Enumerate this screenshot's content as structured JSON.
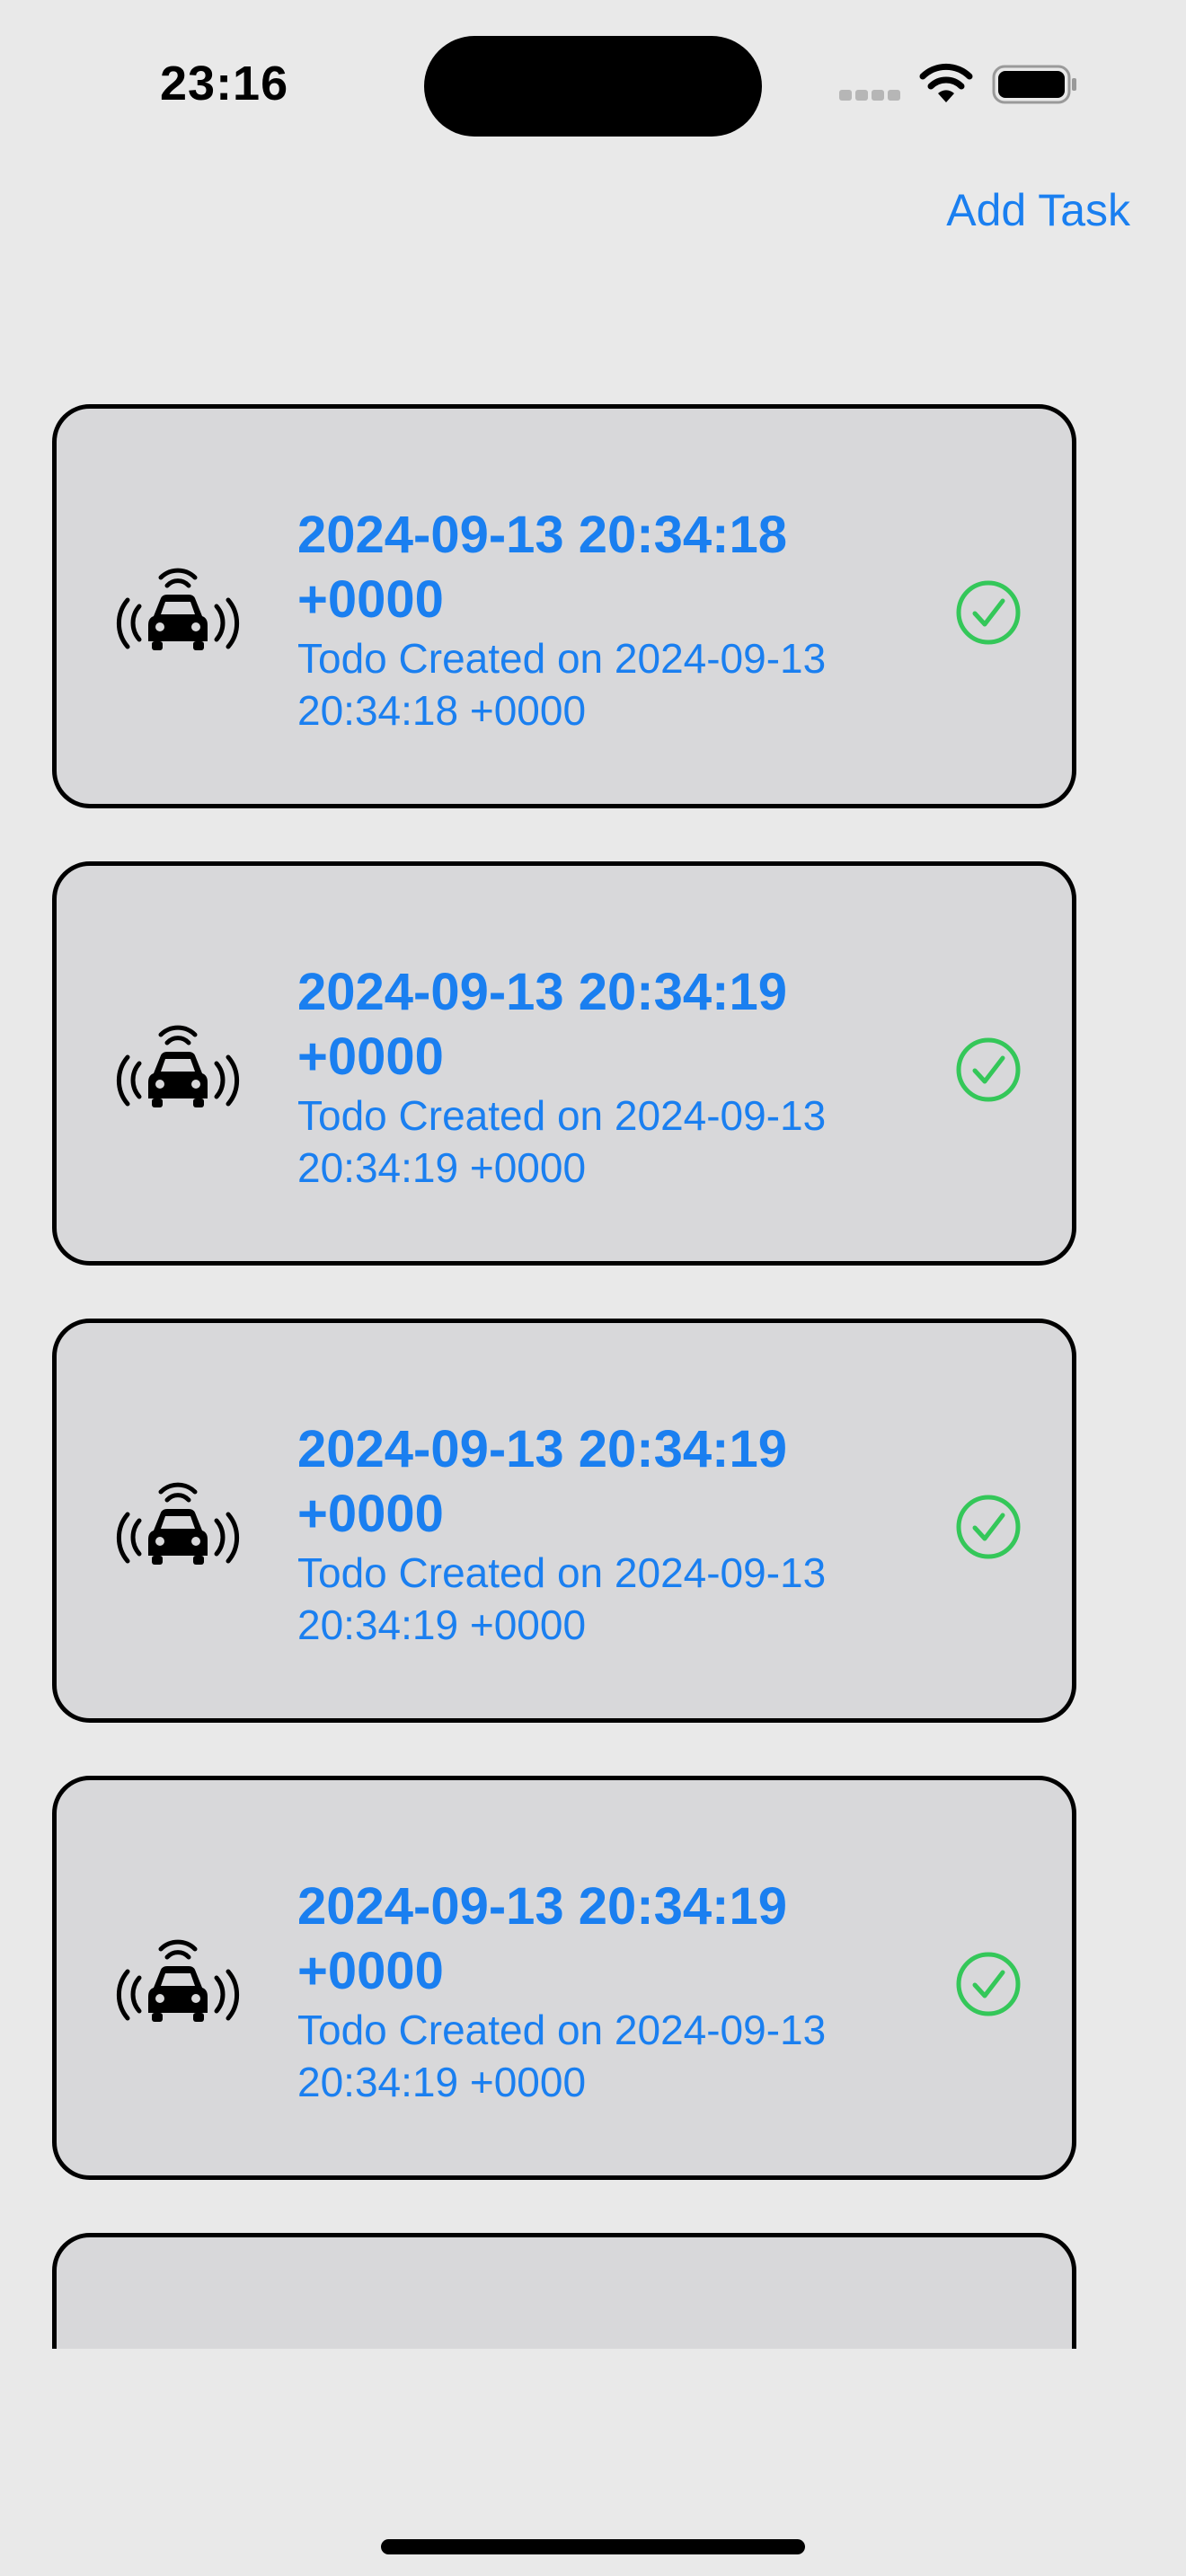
{
  "status_bar": {
    "time": "23:16"
  },
  "nav": {
    "add_task_label": "Add Task"
  },
  "tasks": [
    {
      "title": "2024-09-13 20:34:18 +0000",
      "subtitle": "Todo Created on 2024-09-13 20:34:18 +0000",
      "icon": "car-radio-icon",
      "completed": true
    },
    {
      "title": "2024-09-13 20:34:19 +0000",
      "subtitle": "Todo Created on 2024-09-13 20:34:19 +0000",
      "icon": "car-radio-icon",
      "completed": true
    },
    {
      "title": "2024-09-13 20:34:19 +0000",
      "subtitle": "Todo Created on 2024-09-13 20:34:19 +0000",
      "icon": "car-radio-icon",
      "completed": true
    },
    {
      "title": "2024-09-13 20:34:19 +0000",
      "subtitle": "Todo Created on 2024-09-13 20:34:19 +0000",
      "icon": "car-radio-icon",
      "completed": true
    },
    {
      "title": "",
      "subtitle": "",
      "icon": "car-radio-icon",
      "completed": true
    }
  ],
  "colors": {
    "accent": "#1a7ff0",
    "check": "#34c759",
    "card_background": "#d8d8da",
    "screen_background": "#e9e9e9"
  }
}
